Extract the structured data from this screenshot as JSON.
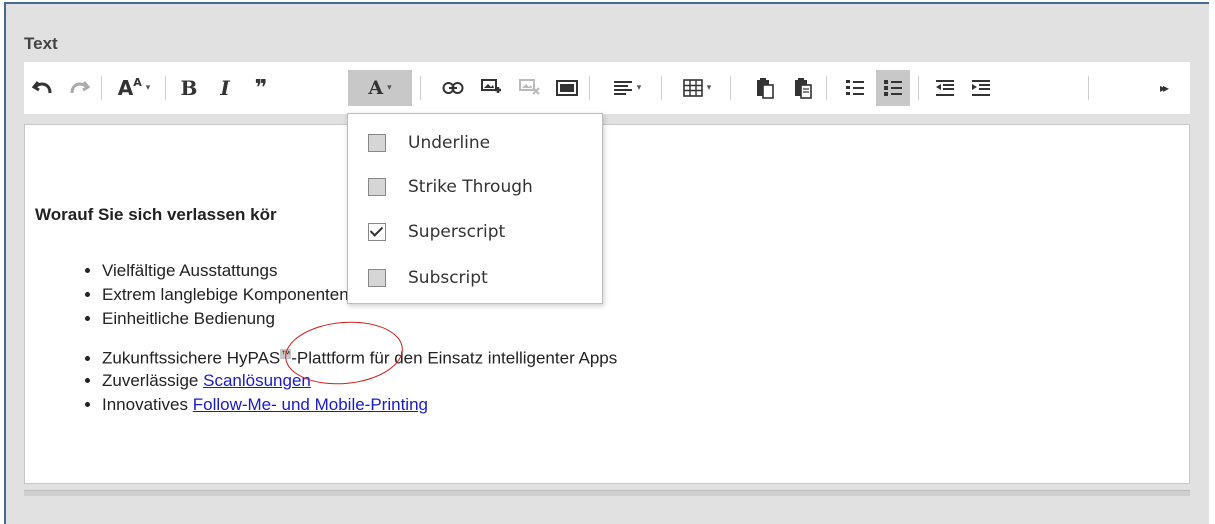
{
  "field_label": "Text",
  "toolbar": {
    "bold": "B",
    "italic": "I",
    "quote": "❞",
    "font_color": "A",
    "font_size": "A",
    "font_size_sup": "A",
    "more": "▸▸",
    "caret": "▾"
  },
  "dropdown": {
    "items": [
      {
        "label": "Underline",
        "checked": false
      },
      {
        "label": "Strike Through",
        "checked": false
      },
      {
        "label": "Superscript",
        "checked": true
      },
      {
        "label": "Subscript",
        "checked": false
      }
    ]
  },
  "editor": {
    "heading": "Worauf Sie sich verlassen kör",
    "items": [
      {
        "text": "Vielfältige Ausstattungs"
      },
      {
        "text": "Extrem langlebige Komponenten"
      },
      {
        "text": "Einheitliche Bedienung"
      },
      {
        "prefix": "Zukunftssichere HyPAS",
        "sup": "™",
        "suffix": "-Plattform für den Einsatz intelligenter Apps"
      },
      {
        "prefix": "Zuverlässige ",
        "link": "Scanlösungen"
      },
      {
        "prefix": "Innovatives ",
        "link": "Follow-Me- und Mobile-Printing"
      }
    ]
  },
  "colors": {
    "annotation": "#d31e1e",
    "link": "#1a1acd",
    "panel_bg": "#e1e1e1"
  }
}
